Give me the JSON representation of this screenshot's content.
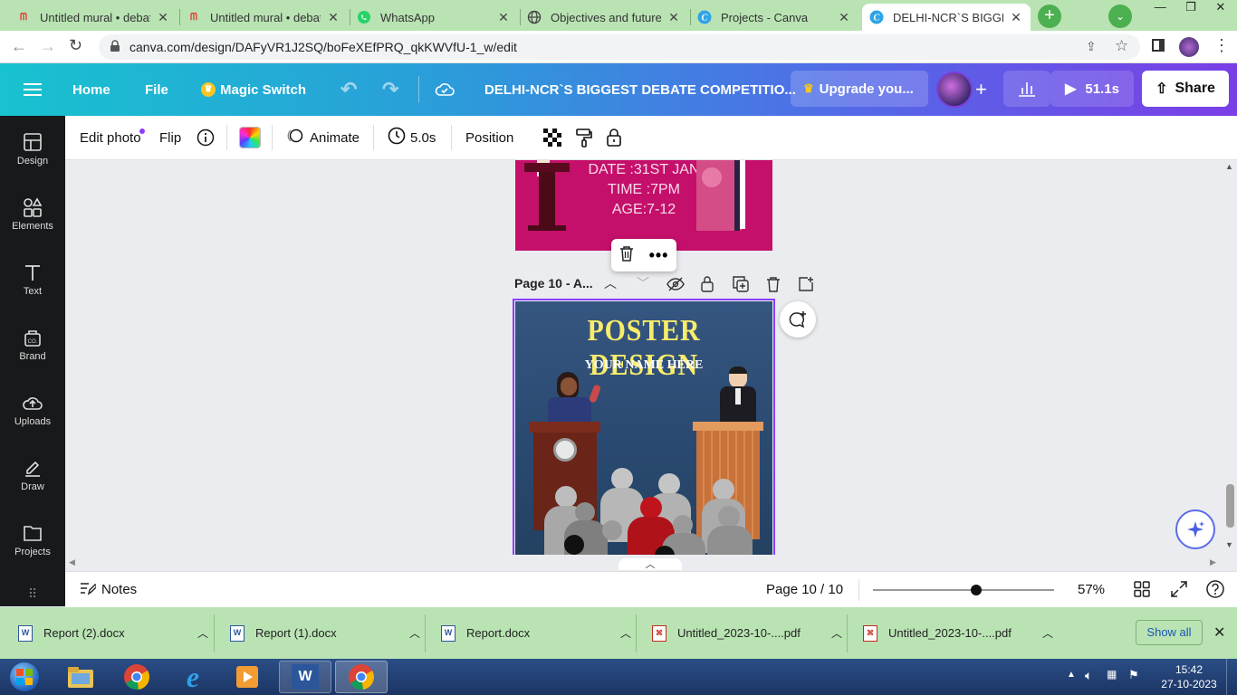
{
  "browser": {
    "tabs": [
      {
        "title": "Untitled mural • debate",
        "icon": "mural-icon",
        "active": false
      },
      {
        "title": "Untitled mural • debate",
        "icon": "mural-icon",
        "active": false
      },
      {
        "title": "WhatsApp",
        "icon": "whatsapp-icon",
        "active": false
      },
      {
        "title": "Objectives and future p",
        "icon": "globe-icon",
        "active": false
      },
      {
        "title": "Projects - Canva",
        "icon": "canva-icon",
        "active": false
      },
      {
        "title": "DELHI-NCR`S BIGGEST",
        "icon": "canva-icon",
        "active": true
      }
    ],
    "url": "canva.com/design/DAFyVR1J2SQ/boFeXEfPRQ_qkKWVfU-1_w/edit"
  },
  "header": {
    "home": "Home",
    "file": "File",
    "magic_switch": "Magic Switch",
    "title": "DELHI-NCR`S BIGGEST DEBATE COMPETITIO...",
    "upgrade": "Upgrade you...",
    "play_time": "51.1s",
    "share": "Share"
  },
  "toolbar": {
    "edit_photo": "Edit photo",
    "flip": "Flip",
    "animate": "Animate",
    "duration": "5.0s",
    "position": "Position"
  },
  "sidebar": {
    "items": [
      {
        "label": "Design",
        "icon": "design-icon"
      },
      {
        "label": "Elements",
        "icon": "elements-icon"
      },
      {
        "label": "Text",
        "icon": "text-icon"
      },
      {
        "label": "Brand",
        "icon": "brand-icon"
      },
      {
        "label": "Uploads",
        "icon": "uploads-icon"
      },
      {
        "label": "Draw",
        "icon": "draw-icon"
      },
      {
        "label": "Projects",
        "icon": "projects-icon"
      }
    ]
  },
  "canvas": {
    "prev_page_lines": [
      "DATE :31ST JAN",
      "TIME :7PM",
      "AGE:7-12"
    ],
    "page_label": "Page 10 - A...",
    "poster_title": "POSTER DESIGN",
    "poster_subtitle": "YOUR NAME  HERE"
  },
  "bottombar": {
    "notes": "Notes",
    "page_indicator": "Page 10 / 10",
    "zoom": "57%",
    "zoom_level": 0.57
  },
  "downloads": {
    "items": [
      {
        "name": "Report (2).docx",
        "icon": "word-doc-icon"
      },
      {
        "name": "Report (1).docx",
        "icon": "word-doc-icon"
      },
      {
        "name": "Report.docx",
        "icon": "word-doc-icon"
      },
      {
        "name": "Untitled_2023-10-....pdf",
        "icon": "pdf-icon"
      },
      {
        "name": "Untitled_2023-10-....pdf",
        "icon": "pdf-icon"
      }
    ],
    "show_all": "Show all"
  },
  "taskbar": {
    "time": "15:42",
    "date": "27-10-2023"
  },
  "colors": {
    "tab_strip": "#b9e3b3",
    "canva_gradient_start": "#18c2cf",
    "canva_gradient_end": "#7a3ee6",
    "sidebar_bg": "#18191b",
    "selection_purple": "#8b3dff",
    "prev_page_pink": "#c4106b",
    "poster_blue": "#2c4a6e"
  }
}
